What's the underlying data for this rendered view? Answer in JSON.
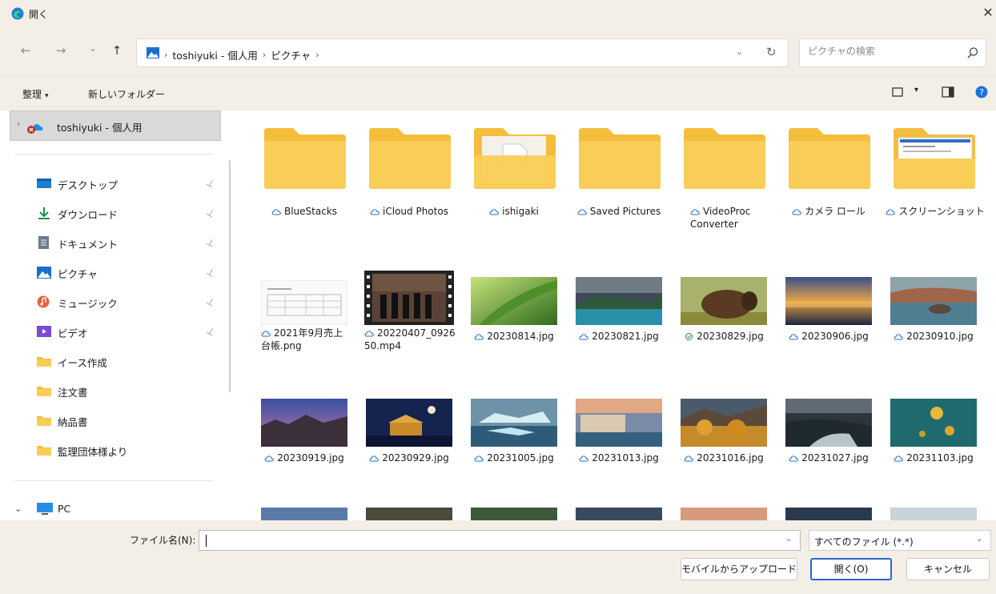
{
  "window": {
    "title": "開く",
    "close_glyph": "✕"
  },
  "nav": {
    "back_glyph": "←",
    "forward_glyph": "→",
    "recent_glyph": "⌄",
    "up_glyph": "↑",
    "breadcrumb": [
      "toshiyuki - 個人用",
      "ピクチャ"
    ],
    "separator": "›",
    "dropdown_glyph": "⌄",
    "refresh_glyph": "↻",
    "search_placeholder": "ピクチャの検索"
  },
  "toolbar": {
    "organize_label": "整理",
    "new_folder_label": "新しいフォルダー",
    "caret": "▾"
  },
  "sidebar": {
    "onedrive_label": "toshiyuki - 個人用",
    "chevron": "›",
    "pin_glyph": "📌",
    "items": [
      {
        "label": "デスクトップ",
        "icon": "desktop-icon",
        "pinned": true
      },
      {
        "label": "ダウンロード",
        "icon": "download-icon",
        "pinned": true
      },
      {
        "label": "ドキュメント",
        "icon": "documents-icon",
        "pinned": true
      },
      {
        "label": "ピクチャ",
        "icon": "pictures-icon",
        "pinned": true
      },
      {
        "label": "ミュージック",
        "icon": "music-icon",
        "pinned": true
      },
      {
        "label": "ビデオ",
        "icon": "videos-icon",
        "pinned": true
      },
      {
        "label": "イース作成",
        "icon": "folder-icon",
        "pinned": false
      },
      {
        "label": "注文書",
        "icon": "folder-icon",
        "pinned": false
      },
      {
        "label": "納品書",
        "icon": "folder-icon",
        "pinned": false
      },
      {
        "label": "監理団体様より",
        "icon": "folder-icon",
        "pinned": false
      }
    ],
    "pc_label": "PC",
    "pc_chevron": "⌄"
  },
  "files": {
    "folders": [
      {
        "name": "BlueStacks",
        "kind": "plain"
      },
      {
        "name": "iCloud Photos",
        "kind": "plain"
      },
      {
        "name": "ishigaki",
        "kind": "document"
      },
      {
        "name": "Saved Pictures",
        "kind": "plain"
      },
      {
        "name": "VideoProc Converter",
        "kind": "plain"
      },
      {
        "name": "カメラ ロール",
        "kind": "plain"
      },
      {
        "name": "スクリーンショット",
        "kind": "screenshot"
      }
    ],
    "row2": [
      {
        "name": "2021年9月売上台帳.png",
        "kind": "sheet",
        "status": "cloud"
      },
      {
        "name": "20220407_092650.mp4",
        "kind": "video",
        "status": "cloud"
      },
      {
        "name": "20230814.jpg",
        "kind": "leaf",
        "status": "cloud"
      },
      {
        "name": "20230821.jpg",
        "kind": "lake",
        "status": "cloud"
      },
      {
        "name": "20230829.jpg",
        "kind": "bison",
        "status": "synced"
      },
      {
        "name": "20230906.jpg",
        "kind": "city",
        "status": "cloud"
      },
      {
        "name": "20230910.jpg",
        "kind": "coast",
        "status": "cloud"
      }
    ],
    "row3": [
      {
        "name": "20230919.jpg",
        "kind": "mountains",
        "status": "cloud"
      },
      {
        "name": "20230929.jpg",
        "kind": "moon",
        "status": "cloud"
      },
      {
        "name": "20231005.jpg",
        "kind": "glacier",
        "status": "cloud"
      },
      {
        "name": "20231013.jpg",
        "kind": "village",
        "status": "cloud"
      },
      {
        "name": "20231016.jpg",
        "kind": "autumn",
        "status": "cloud"
      },
      {
        "name": "20231027.jpg",
        "kind": "river",
        "status": "cloud"
      },
      {
        "name": "20231103.jpg",
        "kind": "jellyfish",
        "status": "cloud"
      }
    ]
  },
  "bottom": {
    "filename_label": "ファイル名(N):",
    "filename_value": "",
    "filetype_value": "すべてのファイル (*.*)",
    "dropdown_glyph": "⌄",
    "upload_button": "モバイルからアップロード",
    "open_button": "開く(O)",
    "cancel_button": "キャンセル"
  },
  "colors": {
    "folder": "#f9cd57",
    "folder_tab": "#f5bd3c",
    "accent": "#2a66d1"
  }
}
